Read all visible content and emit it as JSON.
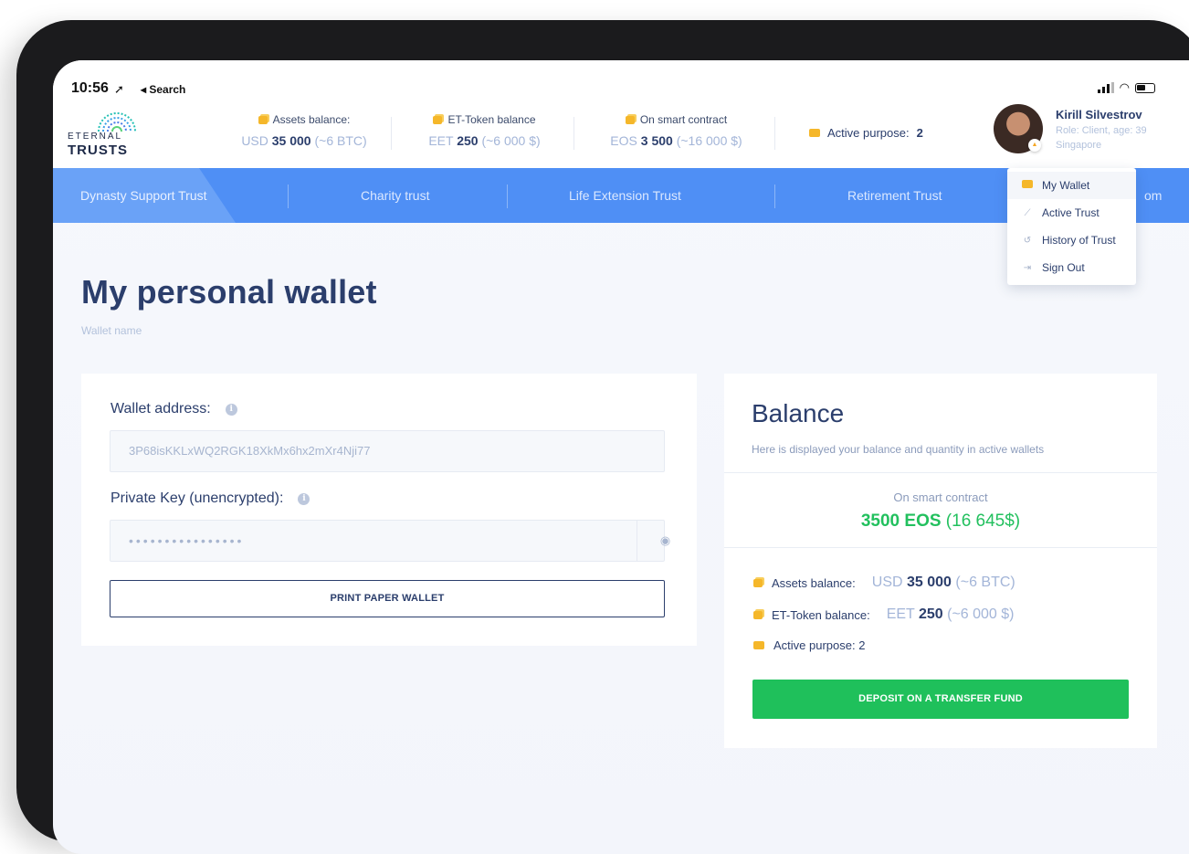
{
  "status_bar": {
    "time": "10:56",
    "location_glyph": "➚",
    "back_label": "◂ Search"
  },
  "header": {
    "logo_top": "ETERNAL",
    "logo_bottom": "TRUSTS",
    "stats": [
      {
        "label": "Assets balance:",
        "prefix": "USD ",
        "amount": "35 000",
        "suffix": " (~6 BTC)"
      },
      {
        "label": "ET-Token balance",
        "prefix": "EET ",
        "amount": "250",
        "suffix": " (~6 000 $)"
      },
      {
        "label": "On smart contract",
        "prefix": "EOS ",
        "amount": "3 500",
        "suffix": " (~16 000 $)"
      }
    ],
    "active_purpose_label": "Active purpose:",
    "active_purpose_value": "2",
    "user": {
      "name": "Kirill Silvestrov",
      "role": "Role: Client, age: 39",
      "city": "Singapore"
    }
  },
  "nav": {
    "items": [
      "Dynasty Support Trust",
      "Charity trust",
      "Life Extension Trust",
      "Retirement Trust",
      "om"
    ]
  },
  "dropdown": {
    "items": [
      {
        "label": "My Wallet",
        "icon": "wallet-icon"
      },
      {
        "label": "Active Trust",
        "icon": "chart-icon"
      },
      {
        "label": "History of Trust",
        "icon": "history-icon"
      },
      {
        "label": "Sign Out",
        "icon": "sign-out-icon"
      }
    ]
  },
  "page": {
    "title": "My personal wallet",
    "subtitle": "Wallet name"
  },
  "wallet": {
    "address_label": "Wallet address:",
    "address_value": "3P68isKKLxWQ2RGK18XkMx6hx2mXr4Nji77",
    "private_key_label": "Private Key (unencrypted):",
    "private_key_masked": "••••••••••••••••",
    "print_button": "PRINT PAPER WALLET"
  },
  "balance": {
    "title": "Balance",
    "description": "Here is displayed your balance and quantity in active wallets",
    "smart_contract_label": "On smart contract",
    "smart_contract_amount": "3500 EOS",
    "smart_contract_usd": " (16 645$)",
    "rows": [
      {
        "label": "Assets balance:",
        "prefix": "USD ",
        "amount": "35 000",
        "suffix": " (~6 BTC)"
      },
      {
        "label": "ET-Token balance:",
        "prefix": "EET ",
        "amount": "250",
        "suffix": " (~6 000 $)"
      }
    ],
    "active_purpose": "Active purpose: 2",
    "deposit_button": "DEPOSIT ON A TRANSFER FUND"
  },
  "colors": {
    "nav_blue": "#4f8ff5",
    "deposit_green": "#1fc05b",
    "heading_navy": "#2b3e6c",
    "coin_yellow": "#f5b72a"
  }
}
